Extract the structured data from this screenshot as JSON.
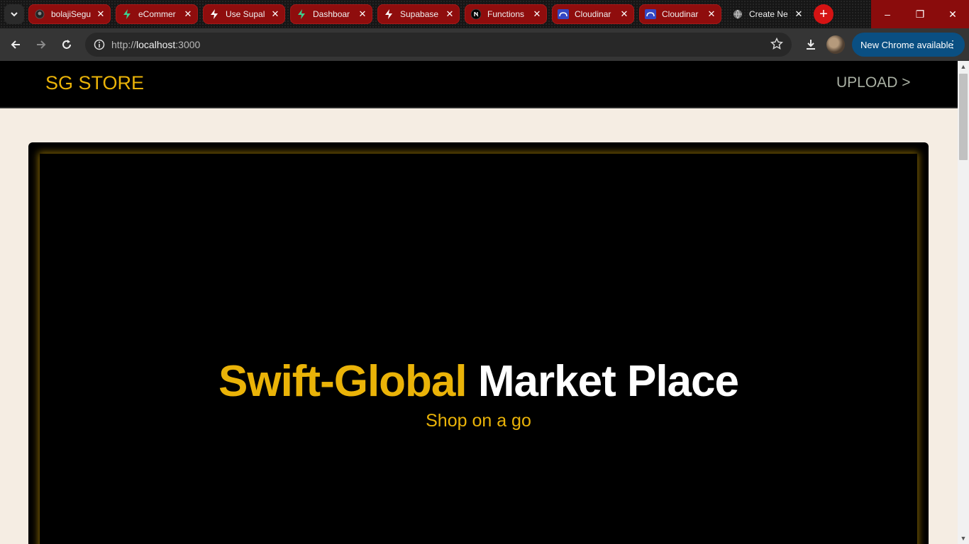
{
  "browser": {
    "tabs": [
      {
        "title": "bolajiSegu",
        "icon": "github-icon"
      },
      {
        "title": "eCommer",
        "icon": "supabase-icon"
      },
      {
        "title": "Use Supal",
        "icon": "supabase-icon"
      },
      {
        "title": "Dashboar",
        "icon": "supabase-icon"
      },
      {
        "title": "Supabase",
        "icon": "supabase-icon"
      },
      {
        "title": "Functions",
        "icon": "nextjs-icon"
      },
      {
        "title": "Cloudinar",
        "icon": "cloudinary-icon"
      },
      {
        "title": "Cloudinar",
        "icon": "cloudinary-icon"
      },
      {
        "title": "Create Ne",
        "icon": "globe-icon"
      }
    ],
    "close_glyph": "✕",
    "new_tab_glyph": "+",
    "url_scheme": "http://",
    "url_host": "localhost",
    "url_port": ":3000",
    "update_label": "New Chrome available",
    "window_controls": {
      "minimize": "–",
      "restore": "❐",
      "close": "✕"
    },
    "colors": {
      "tab_bg": "#8f0d0d",
      "new_tab": "#d51313",
      "update_bg": "#0a4f82"
    }
  },
  "site": {
    "brand": "SG STORE",
    "upload_link": "UPLOAD >",
    "hero": {
      "title_accent": "Swift-Global",
      "title_rest": "Market Place",
      "subtitle": "Shop on a go"
    },
    "colors": {
      "accent": "#eab308",
      "page_bg": "#f5ede3",
      "nav_bg": "#000000"
    }
  }
}
